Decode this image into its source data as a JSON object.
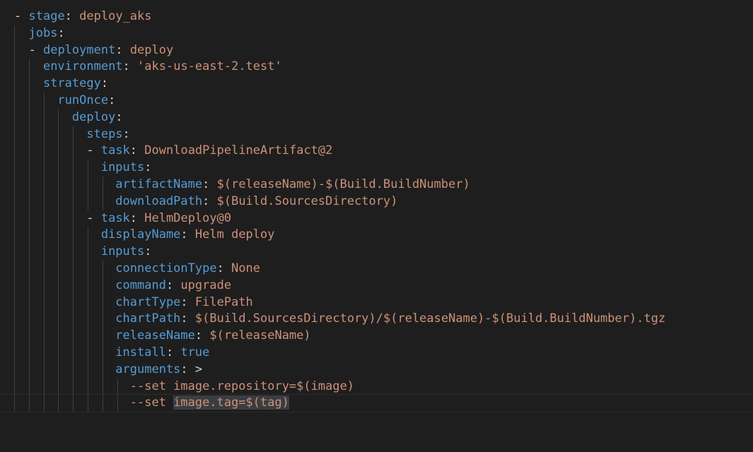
{
  "editor": {
    "language": "yaml",
    "theme_colors": {
      "background": "#1e1e1e",
      "key": "#569cd6",
      "string": "#ce9178",
      "punctuation": "#d4d4d4",
      "indent_guide": "#404040",
      "selection": "#3a3d41"
    },
    "lines": [
      {
        "dash": "- ",
        "key": "stage",
        "sep": ": ",
        "value": "deploy_aks"
      },
      {
        "key": "jobs",
        "sep": ":"
      },
      {
        "dash": "- ",
        "key": "deployment",
        "sep": ": ",
        "value": "deploy"
      },
      {
        "key": "environment",
        "sep": ": ",
        "value": "'aks-us-east-2.test'"
      },
      {
        "key": "strategy",
        "sep": ":"
      },
      {
        "key": "runOnce",
        "sep": ":"
      },
      {
        "key": "deploy",
        "sep": ":"
      },
      {
        "key": "steps",
        "sep": ":"
      },
      {
        "dash": "- ",
        "key": "task",
        "sep": ": ",
        "value": "DownloadPipelineArtifact@2"
      },
      {
        "key": "inputs",
        "sep": ":"
      },
      {
        "key": "artifactName",
        "sep": ": ",
        "value": "$(releaseName)-$(Build.BuildNumber)"
      },
      {
        "key": "downloadPath",
        "sep": ": ",
        "value": "$(Build.SourcesDirectory)"
      },
      {
        "dash": "- ",
        "key": "task",
        "sep": ": ",
        "value": "HelmDeploy@0"
      },
      {
        "key": "displayName",
        "sep": ": ",
        "value": "Helm deploy"
      },
      {
        "key": "inputs",
        "sep": ":"
      },
      {
        "key": "connectionType",
        "sep": ": ",
        "value": "None"
      },
      {
        "key": "command",
        "sep": ": ",
        "value": "upgrade"
      },
      {
        "key": "chartType",
        "sep": ": ",
        "value": "FilePath"
      },
      {
        "key": "chartPath",
        "sep": ": ",
        "value": "$(Build.SourcesDirectory)/$(releaseName)-$(Build.BuildNumber).tgz"
      },
      {
        "key": "releaseName",
        "sep": ": ",
        "value": "$(releaseName)"
      },
      {
        "key": "install",
        "sep": ": ",
        "value": "true"
      },
      {
        "key": "arguments",
        "sep": ": ",
        "value": ">"
      },
      {
        "text": "--set image.repository=$(image)"
      },
      {
        "text": "--set ",
        "selected": "image.tag=$(tag)"
      }
    ]
  }
}
